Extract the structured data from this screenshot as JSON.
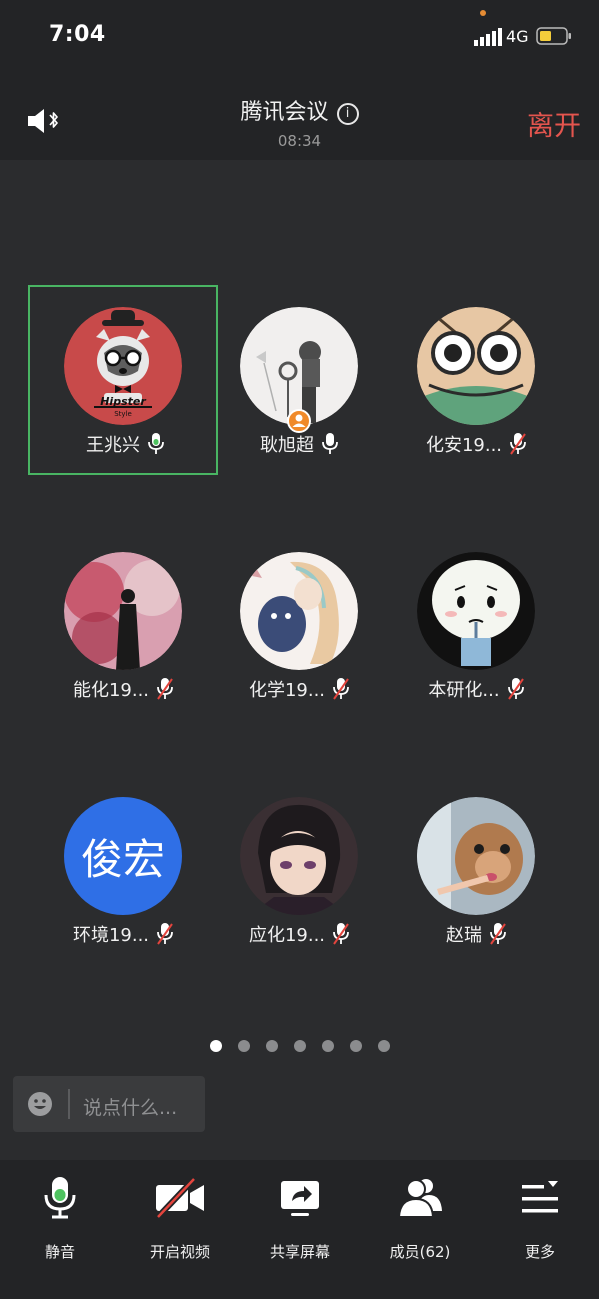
{
  "status_bar": {
    "time": "7:04",
    "network": "4G"
  },
  "header": {
    "title": "腾讯会议",
    "timer": "08:34",
    "leave_label": "离开"
  },
  "participants": [
    {
      "name": "王兆兴",
      "mic": "on",
      "active": true
    },
    {
      "name": "耿旭超",
      "mic": "on",
      "host": true
    },
    {
      "name": "化安19...",
      "mic": "muted"
    },
    {
      "name": "能化19...",
      "mic": "muted"
    },
    {
      "name": "化学19...",
      "mic": "muted"
    },
    {
      "name": "本研化...",
      "mic": "muted"
    },
    {
      "name": "环境19...",
      "mic": "muted",
      "avatar_text": "俊宏"
    },
    {
      "name": "应化19...",
      "mic": "muted"
    },
    {
      "name": "赵瑞",
      "mic": "muted"
    }
  ],
  "page_indicator": {
    "total": 7,
    "current": 1
  },
  "chat": {
    "placeholder": "说点什么..."
  },
  "toolbar": [
    {
      "label": "静音",
      "icon": "microphone-icon"
    },
    {
      "label": "开启视频",
      "icon": "video-off-icon"
    },
    {
      "label": "共享屏幕",
      "icon": "share-screen-icon"
    },
    {
      "label": "成员(62)",
      "icon": "members-icon"
    },
    {
      "label": "更多",
      "icon": "more-menu-icon"
    }
  ],
  "colors": {
    "leave": "#e4554e",
    "active_border": "#49b563",
    "host_badge": "#f08a2a",
    "avatar_blue": "#2f6fe6"
  }
}
